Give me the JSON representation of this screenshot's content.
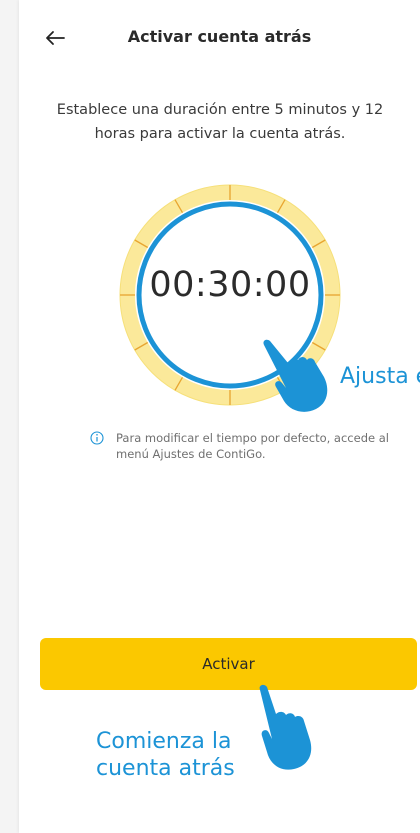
{
  "header": {
    "title": "Activar cuenta atrás",
    "back_icon": "arrow-left-icon"
  },
  "description": "Establece una duración entre 5 minutos y 12 horas para activar la cuenta atrás.",
  "timer": {
    "value": "00:30:00"
  },
  "hints": {
    "adjust_time": "Ajusta el tiempo",
    "start_countdown": "Comienza la cuenta atrás"
  },
  "info": {
    "icon": "info-icon",
    "text": "Para modificar el tiempo por defecto, accede al menú Ajustes de ContiGo."
  },
  "actions": {
    "activate_label": "Activar"
  },
  "colors": {
    "accent_yellow": "#fbc800",
    "ring_yellow": "#fbe99a",
    "ring_blue": "#1c93d6",
    "hint_blue": "#1c93d6"
  }
}
